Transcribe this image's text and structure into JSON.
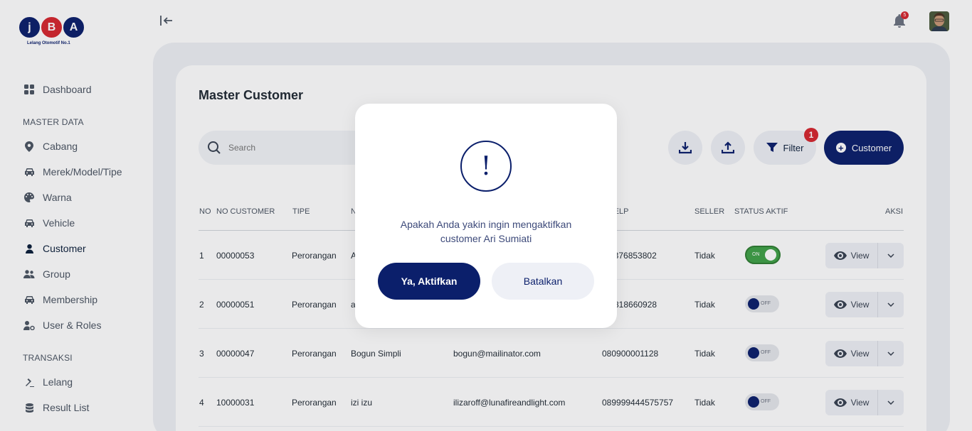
{
  "brand": {
    "letters": [
      "j",
      "B",
      "A"
    ],
    "tagline": "Lelang Otomotif No.1"
  },
  "sidebar": {
    "items": [
      {
        "label": "Dashboard",
        "icon": "dashboard-grid-icon"
      },
      {
        "label": "Cabang",
        "icon": "location-pin-icon"
      },
      {
        "label": "Merek/Model/Tipe",
        "icon": "car-icon"
      },
      {
        "label": "Warna",
        "icon": "palette-icon"
      },
      {
        "label": "Vehicle",
        "icon": "car-icon"
      },
      {
        "label": "Customer",
        "icon": "user-icon"
      },
      {
        "label": "Group",
        "icon": "users-icon"
      },
      {
        "label": "Membership",
        "icon": "car-icon"
      },
      {
        "label": "User & Roles",
        "icon": "user-gear-icon"
      },
      {
        "label": "Lelang",
        "icon": "gavel-icon"
      },
      {
        "label": "Result List",
        "icon": "database-icon"
      }
    ],
    "sections": {
      "master": "MASTER DATA",
      "transaksi": "TRANSAKSI"
    },
    "active": "Customer"
  },
  "topbar": {
    "notification_count": "5"
  },
  "page": {
    "title": "Master Customer",
    "search_placeholder": "Search",
    "filter_label": "Filter",
    "filter_count": "1",
    "add_label": "Customer"
  },
  "table": {
    "headers": [
      "NO",
      "NO CUSTOMER",
      "TIPE",
      "N",
      "TELP",
      "SELLER",
      "STATUS AKTIF",
      "AKSI"
    ],
    "rows": [
      {
        "no": "1",
        "no_customer": "00000053",
        "tipe": "Perorangan",
        "nama": "A",
        "email": "",
        "telp": "5376853802",
        "seller": "Tidak",
        "status": "ON",
        "active": true,
        "view": "View"
      },
      {
        "no": "2",
        "no_customer": "00000051",
        "tipe": "Perorangan",
        "nama": "a",
        "email": "",
        "telp": "818660928",
        "seller": "Tidak",
        "status": "OFF",
        "active": false,
        "view": "View"
      },
      {
        "no": "3",
        "no_customer": "00000047",
        "tipe": "Perorangan",
        "nama": "Bogun Simpli",
        "email": "bogun@mailinator.com",
        "telp": "080900001128",
        "seller": "Tidak",
        "status": "OFF",
        "active": false,
        "view": "View"
      },
      {
        "no": "4",
        "no_customer": "10000031",
        "tipe": "Perorangan",
        "nama": "izi izu",
        "email": "ilizaroff@lunafireandlight.com",
        "telp": "089999444575757",
        "seller": "Tidak",
        "status": "OFF",
        "active": false,
        "view": "View"
      }
    ]
  },
  "modal": {
    "icon": "exclamation-icon",
    "symbol": "!",
    "message_line1": "Apakah Anda yakin ingin mengaktifkan",
    "message_line2": "customer Ari Sumiati",
    "confirm_label": "Ya, Aktifkan",
    "cancel_label": "Batalkan"
  },
  "colors": {
    "primary": "#0b1f6b",
    "danger": "#d6262e",
    "success": "#3fa147"
  }
}
